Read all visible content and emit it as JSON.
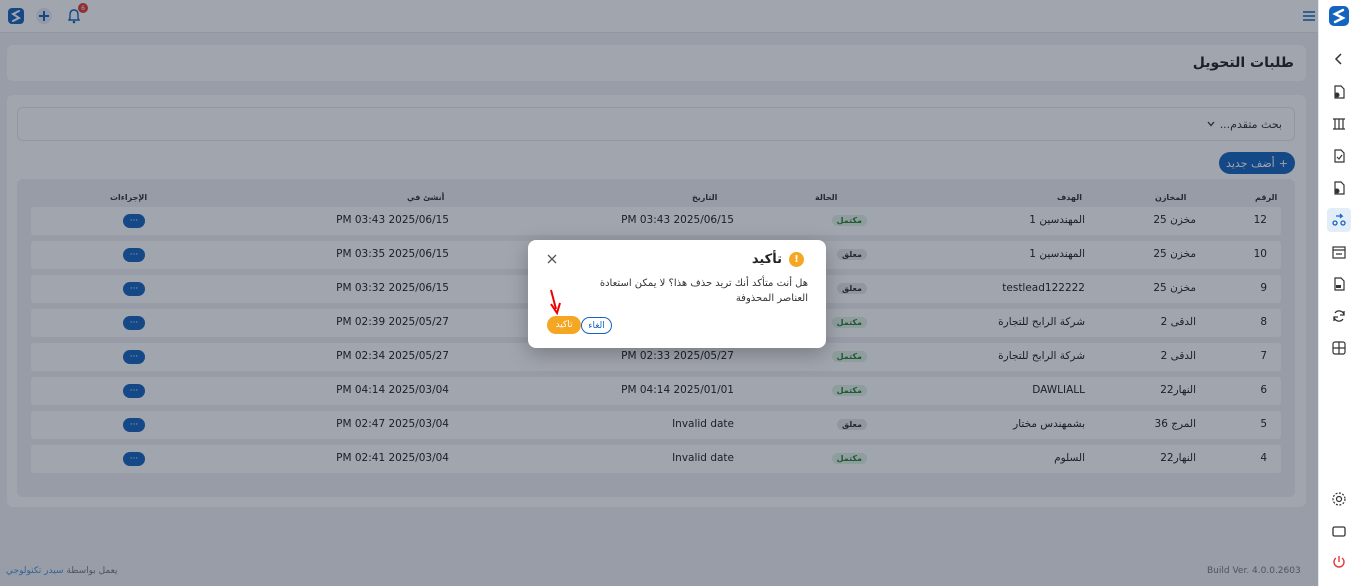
{
  "topbar": {
    "notification_count": "6"
  },
  "page": {
    "title": "طلبات التحويل"
  },
  "search": {
    "label": "بحث متقدم..."
  },
  "toolbar": {
    "add_label": "أضف جديد",
    "add_symbol": "+"
  },
  "table": {
    "columns": {
      "number": "الرقم",
      "warehouse": "المخازن",
      "target": "الهدف",
      "status": "الحالة",
      "date": "التاريخ",
      "created": "أنشئ في",
      "actions": "الإجراءات"
    },
    "action_label": "···",
    "rows": [
      {
        "number": "12",
        "warehouse": "مخزن 25",
        "target": "المهندسين 1",
        "status": "مكتمل",
        "date": "PM 03:43 2025/06/15",
        "created": "PM 03:43 2025/06/15"
      },
      {
        "number": "10",
        "warehouse": "مخزن 25",
        "target": "المهندسين 1",
        "status": "معلق",
        "date": "",
        "created": "PM 03:35 2025/06/15"
      },
      {
        "number": "9",
        "warehouse": "مخزن 25",
        "target": "testlead122222",
        "status": "معلق",
        "date": "",
        "created": "PM 03:32 2025/06/15"
      },
      {
        "number": "8",
        "warehouse": "الدقى 2",
        "target": "شركة الرابح للتجارة",
        "status": "مكتمل",
        "date": "",
        "created": "PM 02:39 2025/05/27"
      },
      {
        "number": "7",
        "warehouse": "الدقى 2",
        "target": "شركة الرابح للتجارة",
        "status": "مكتمل",
        "date": "PM 02:33 2025/05/27",
        "created": "PM 02:34 2025/05/27"
      },
      {
        "number": "6",
        "warehouse": "النهار22",
        "target": "DAWLIALL",
        "status": "مكتمل",
        "date": "PM 04:14 2025/01/01",
        "created": "PM 04:14 2025/03/04"
      },
      {
        "number": "5",
        "warehouse": "المرج 36",
        "target": "بشمهندس مختار",
        "status": "معلق",
        "date": "Invalid date",
        "created": "PM 02:47 2025/03/04"
      },
      {
        "number": "4",
        "warehouse": "النهار22",
        "target": "السلوم",
        "status": "مكتمل",
        "date": "Invalid date",
        "created": "PM 02:41 2025/03/04"
      }
    ]
  },
  "dialog": {
    "title": "تأكيد",
    "icon": "!",
    "message": "هل أنت متأكد أنك تريد حذف هذا؟ لا يمكن استعادة العناصر المحذوفة",
    "cancel_label": "الغاء",
    "confirm_label": "تاكيد"
  },
  "footer": {
    "powered_prefix": "يعمل بواسطة",
    "brand": "سيدر تكنولوجي",
    "build": "Build Ver. 4.0.0.2603"
  },
  "colors": {
    "primary": "#1565c0",
    "warning": "#f5a623",
    "success": "#2e7d32"
  }
}
